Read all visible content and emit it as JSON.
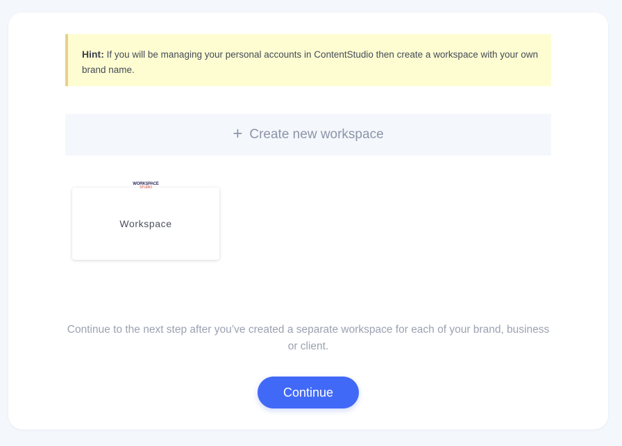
{
  "hint": {
    "label": "Hint:",
    "text": " If you will be managing your personal accounts in ContentStudio then create a workspace with your own brand name."
  },
  "create_workspace": {
    "plus_icon": "+",
    "label": "Create new workspace"
  },
  "workspaces": [
    {
      "logo_line1": "WORKSPACE",
      "logo_line2": "STUDIO",
      "name": "Workspace"
    }
  ],
  "footer": {
    "instruction": "Continue to the next step after you’ve created a separate workspace for each of your brand, business or client.",
    "continue_label": "Continue"
  },
  "colors": {
    "accent": "#4169f7",
    "hint_bg": "#fefdd2",
    "hint_border": "#e8d08a",
    "page_bg": "#f4f7fb"
  }
}
